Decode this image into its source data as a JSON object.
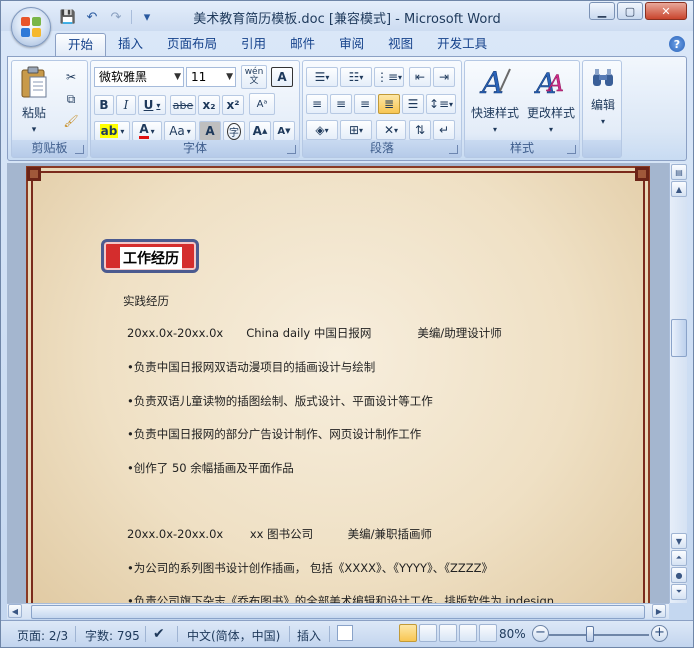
{
  "window": {
    "title": "美术教育简历模板.doc [兼容模式] - Microsoft Word",
    "minimize": "▁",
    "maximize": "▢",
    "close": "✕"
  },
  "qat": {
    "save_icon": "💾",
    "undo_icon": "↶",
    "redo_icon": "↷",
    "customize_icon": "▾"
  },
  "tabs": [
    {
      "label": "开始",
      "active": true
    },
    {
      "label": "插入"
    },
    {
      "label": "页面布局"
    },
    {
      "label": "引用"
    },
    {
      "label": "邮件"
    },
    {
      "label": "审阅"
    },
    {
      "label": "视图"
    },
    {
      "label": "开发工具"
    }
  ],
  "help": "?",
  "ribbon": {
    "clipboard": {
      "label": "剪贴板",
      "paste": "粘贴",
      "paste_arrow": "▾"
    },
    "font": {
      "label": "字体",
      "font_name": "微软雅黑",
      "font_size": "11",
      "bold": "B",
      "italic": "I",
      "underline": "U",
      "strike": "abe",
      "subscript": "x₂",
      "superscript": "x²",
      "highlight": "ab",
      "font_color": "A",
      "change_case": "Aa",
      "char_shading": "A",
      "enclose": "字",
      "grow": "A",
      "shrink": "A",
      "phonetic": "wén\n文",
      "border": "A",
      "clear": "Aᵃ"
    },
    "paragraph": {
      "label": "段落"
    },
    "styles": {
      "label": "样式",
      "quick_styles": "快速样式",
      "change_styles": "更改样式"
    },
    "editing": {
      "label": "编辑",
      "editing": "编辑"
    }
  },
  "document": {
    "section_title": "工作经历",
    "lines": [
      "实践经历",
      "20xx.0x-20xx.0x　　China daily 中国日报网　　　　美编/助理设计师",
      "•负责中国日报网双语动漫项目的插画设计与绘制",
      "•负责双语儿童读物的插图绘制、版式设计、平面设计等工作",
      "•负责中国日报网的部分广告设计制作、网页设计制作工作",
      "•创作了 50 余幅插画及平面作品",
      "20xx.0x-20xx.0x　　 xx 图书公司　　　美编/兼职插画师",
      "•为公司的系列图书设计创作插画， 包括《XXXX》、《YYYY》、《ZZZZ》",
      "•负责公司旗下杂志《乔布图书》的全部美术编辑和设计工作，排版软件为 indesign"
    ]
  },
  "status": {
    "page": "页面: 2/3",
    "words": "字数: 795",
    "language": "中文(简体，中国)",
    "mode": "插入",
    "zoom": "80%",
    "zoom_minus": "−",
    "zoom_plus": "+"
  }
}
